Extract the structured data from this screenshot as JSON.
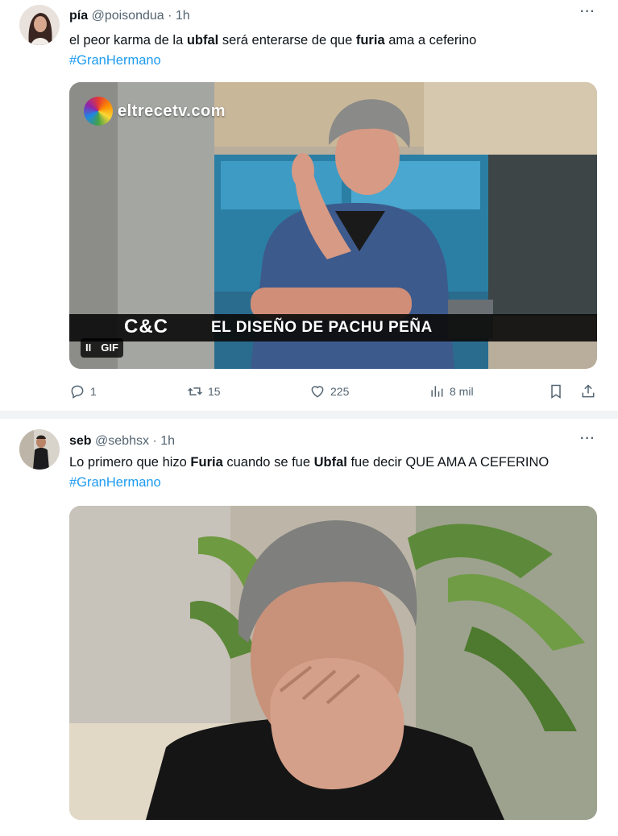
{
  "tweets": [
    {
      "display_name": "pía",
      "handle": "@poisondua",
      "separator": "·",
      "time": "1h",
      "more": "···",
      "text": {
        "t1": "el peor karma de la ",
        "b1": "ubfal",
        "t2": " será enterarse de que ",
        "b2": "furia",
        "t3": " ama a ceferino",
        "hashtag": "#GranHermano"
      },
      "media": {
        "logo_text": "eltrecetv.com",
        "corner_logo": "C&C",
        "caption": "EL DISEÑO DE PACHU PEÑA",
        "pause_label": "II",
        "gif_label": "GIF"
      },
      "actions": {
        "replies": "1",
        "retweets": "15",
        "likes": "225",
        "views": "8 mil"
      }
    },
    {
      "display_name": "seb",
      "handle": "@sebhsx",
      "separator": "·",
      "time": "1h",
      "more": "···",
      "text": {
        "t1": "Lo primero que hizo ",
        "b1": "Furia",
        "t2": " cuando se fue ",
        "b2": "Ubfal",
        "t3": " fue decir QUE AMA A CEFERINO ",
        "hashtag": "#GranHermano"
      }
    }
  ],
  "colors": {
    "link": "#1d9bf0",
    "secondary_text": "#536471",
    "primary_text": "#0f1419",
    "separator_bg": "#f2f3f5"
  },
  "icons": [
    "more-icon",
    "reply-icon",
    "retweet-icon",
    "like-icon",
    "views-icon",
    "bookmark-icon",
    "share-icon"
  ]
}
